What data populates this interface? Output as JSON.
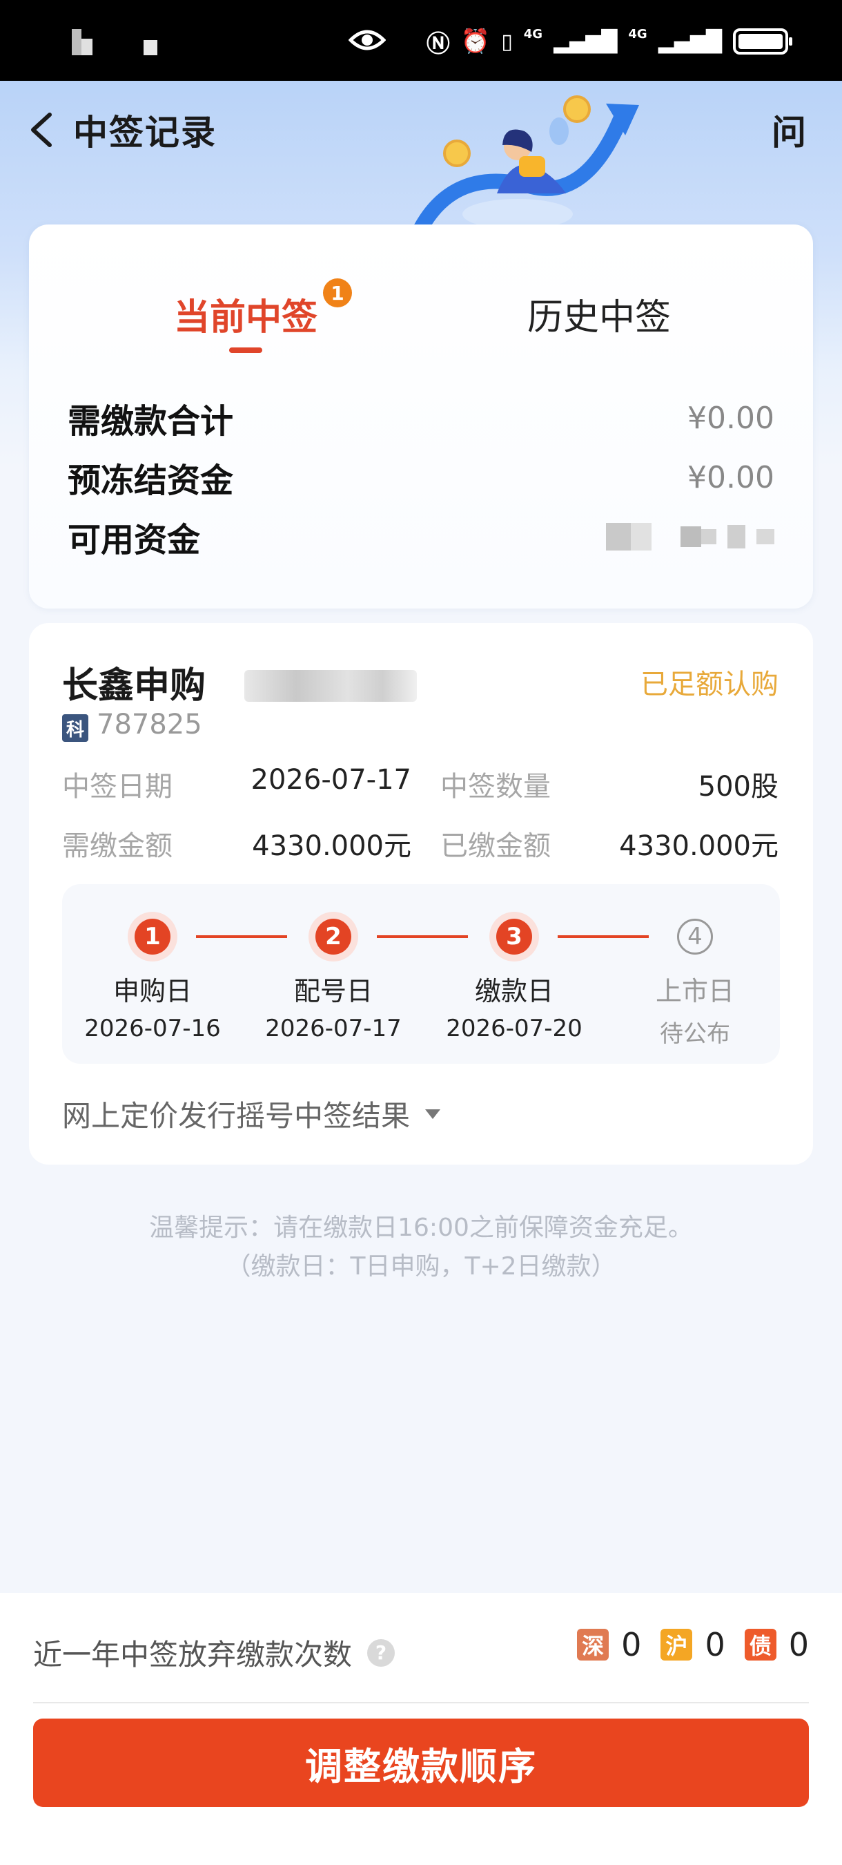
{
  "colors": {
    "accent": "#e0452a",
    "status_gold": "#e8a93a",
    "badge_orange": "#f08218",
    "button_red": "#e9451f",
    "shen_badge": "#e07a52",
    "hu_badge": "#f4a624",
    "zhai_badge": "#ee5b2b"
  },
  "status_bar": {
    "network_1": "4G",
    "network_2": "4G"
  },
  "header": {
    "title": "中签记录",
    "help_label": "问"
  },
  "tabs": {
    "current": "当前中签",
    "current_badge": "1",
    "history": "历史中签"
  },
  "summary": {
    "rows": [
      {
        "label": "需缴款合计",
        "value": "¥0.00"
      },
      {
        "label": "预冻结资金",
        "value": "¥0.00"
      },
      {
        "label": "可用资金",
        "value": ""
      }
    ]
  },
  "allocation": {
    "stock_name": "长鑫申购",
    "status": "已足额认购",
    "board_badge": "科",
    "stock_code": "787825",
    "fields": [
      {
        "label": "中签日期",
        "value": "2026-07-17"
      },
      {
        "label": "中签数量",
        "value": "500股"
      },
      {
        "label": "需缴金额",
        "value": "4330.000元"
      },
      {
        "label": "已缴金额",
        "value": "4330.000元"
      }
    ],
    "steps": [
      {
        "num": "1",
        "name": "申购日",
        "date": "2026-07-16",
        "done": true
      },
      {
        "num": "2",
        "name": "配号日",
        "date": "2026-07-17",
        "done": true
      },
      {
        "num": "3",
        "name": "缴款日",
        "date": "2026-07-20",
        "done": true
      },
      {
        "num": "4",
        "name": "上市日",
        "date": "待公布",
        "done": false
      }
    ],
    "result_toggle": "网上定价发行摇号中签结果"
  },
  "tip": {
    "line1": "温馨提示：请在缴款日16:00之前保障资金充足。",
    "line2": "（缴款日：T日申购，T+2日缴款）"
  },
  "bottom": {
    "abandon_label": "近一年中签放弃缴款次数",
    "counts": [
      {
        "market": "深",
        "count": "0"
      },
      {
        "market": "沪",
        "count": "0"
      },
      {
        "market": "债",
        "count": "0"
      }
    ],
    "button_label": "调整缴款顺序"
  }
}
